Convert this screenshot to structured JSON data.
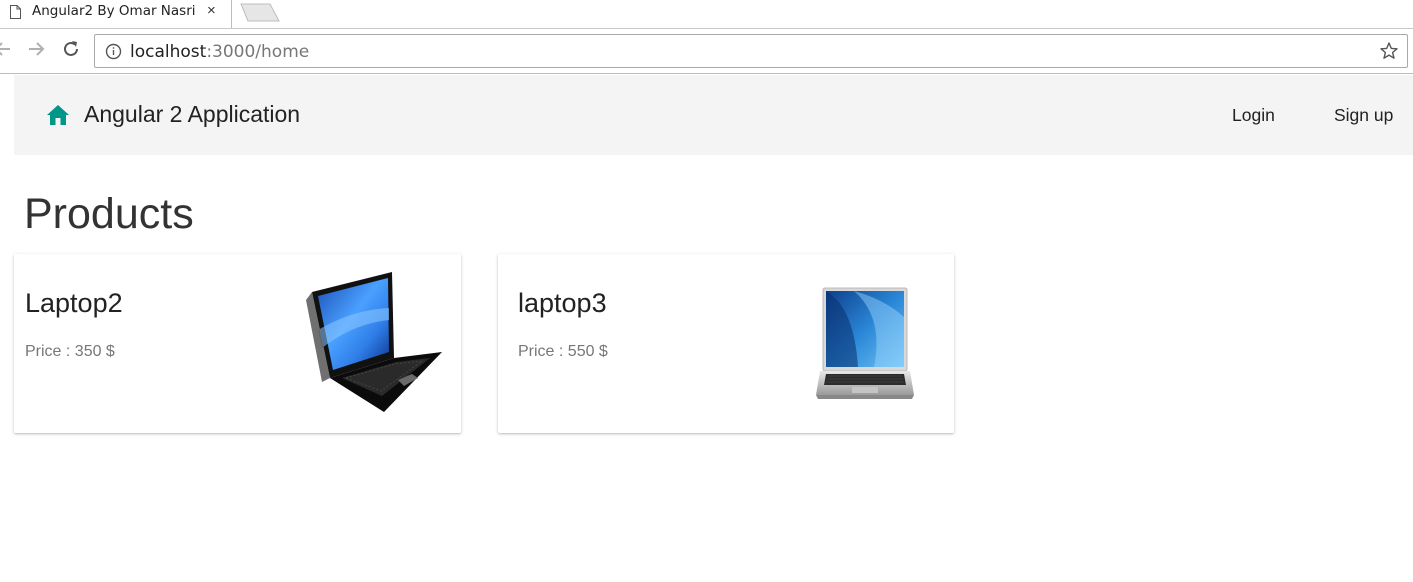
{
  "browser": {
    "tab_title": "Angular2 By Omar Nasri",
    "tab_close": "×",
    "url_host": "localhost",
    "url_rest": ":3000/home"
  },
  "navbar": {
    "brand": "Angular 2 Application",
    "brand_icon": "home-icon",
    "accent_color": "#009688",
    "links": [
      {
        "label": "Login"
      },
      {
        "label": "Sign up"
      }
    ]
  },
  "page": {
    "title": "Products"
  },
  "products": [
    {
      "name": "Laptop2",
      "price": "Price : 350 $",
      "image": "laptop-black-image"
    },
    {
      "name": "laptop3",
      "price": "Price : 550 $",
      "image": "laptop-silver-image"
    }
  ]
}
